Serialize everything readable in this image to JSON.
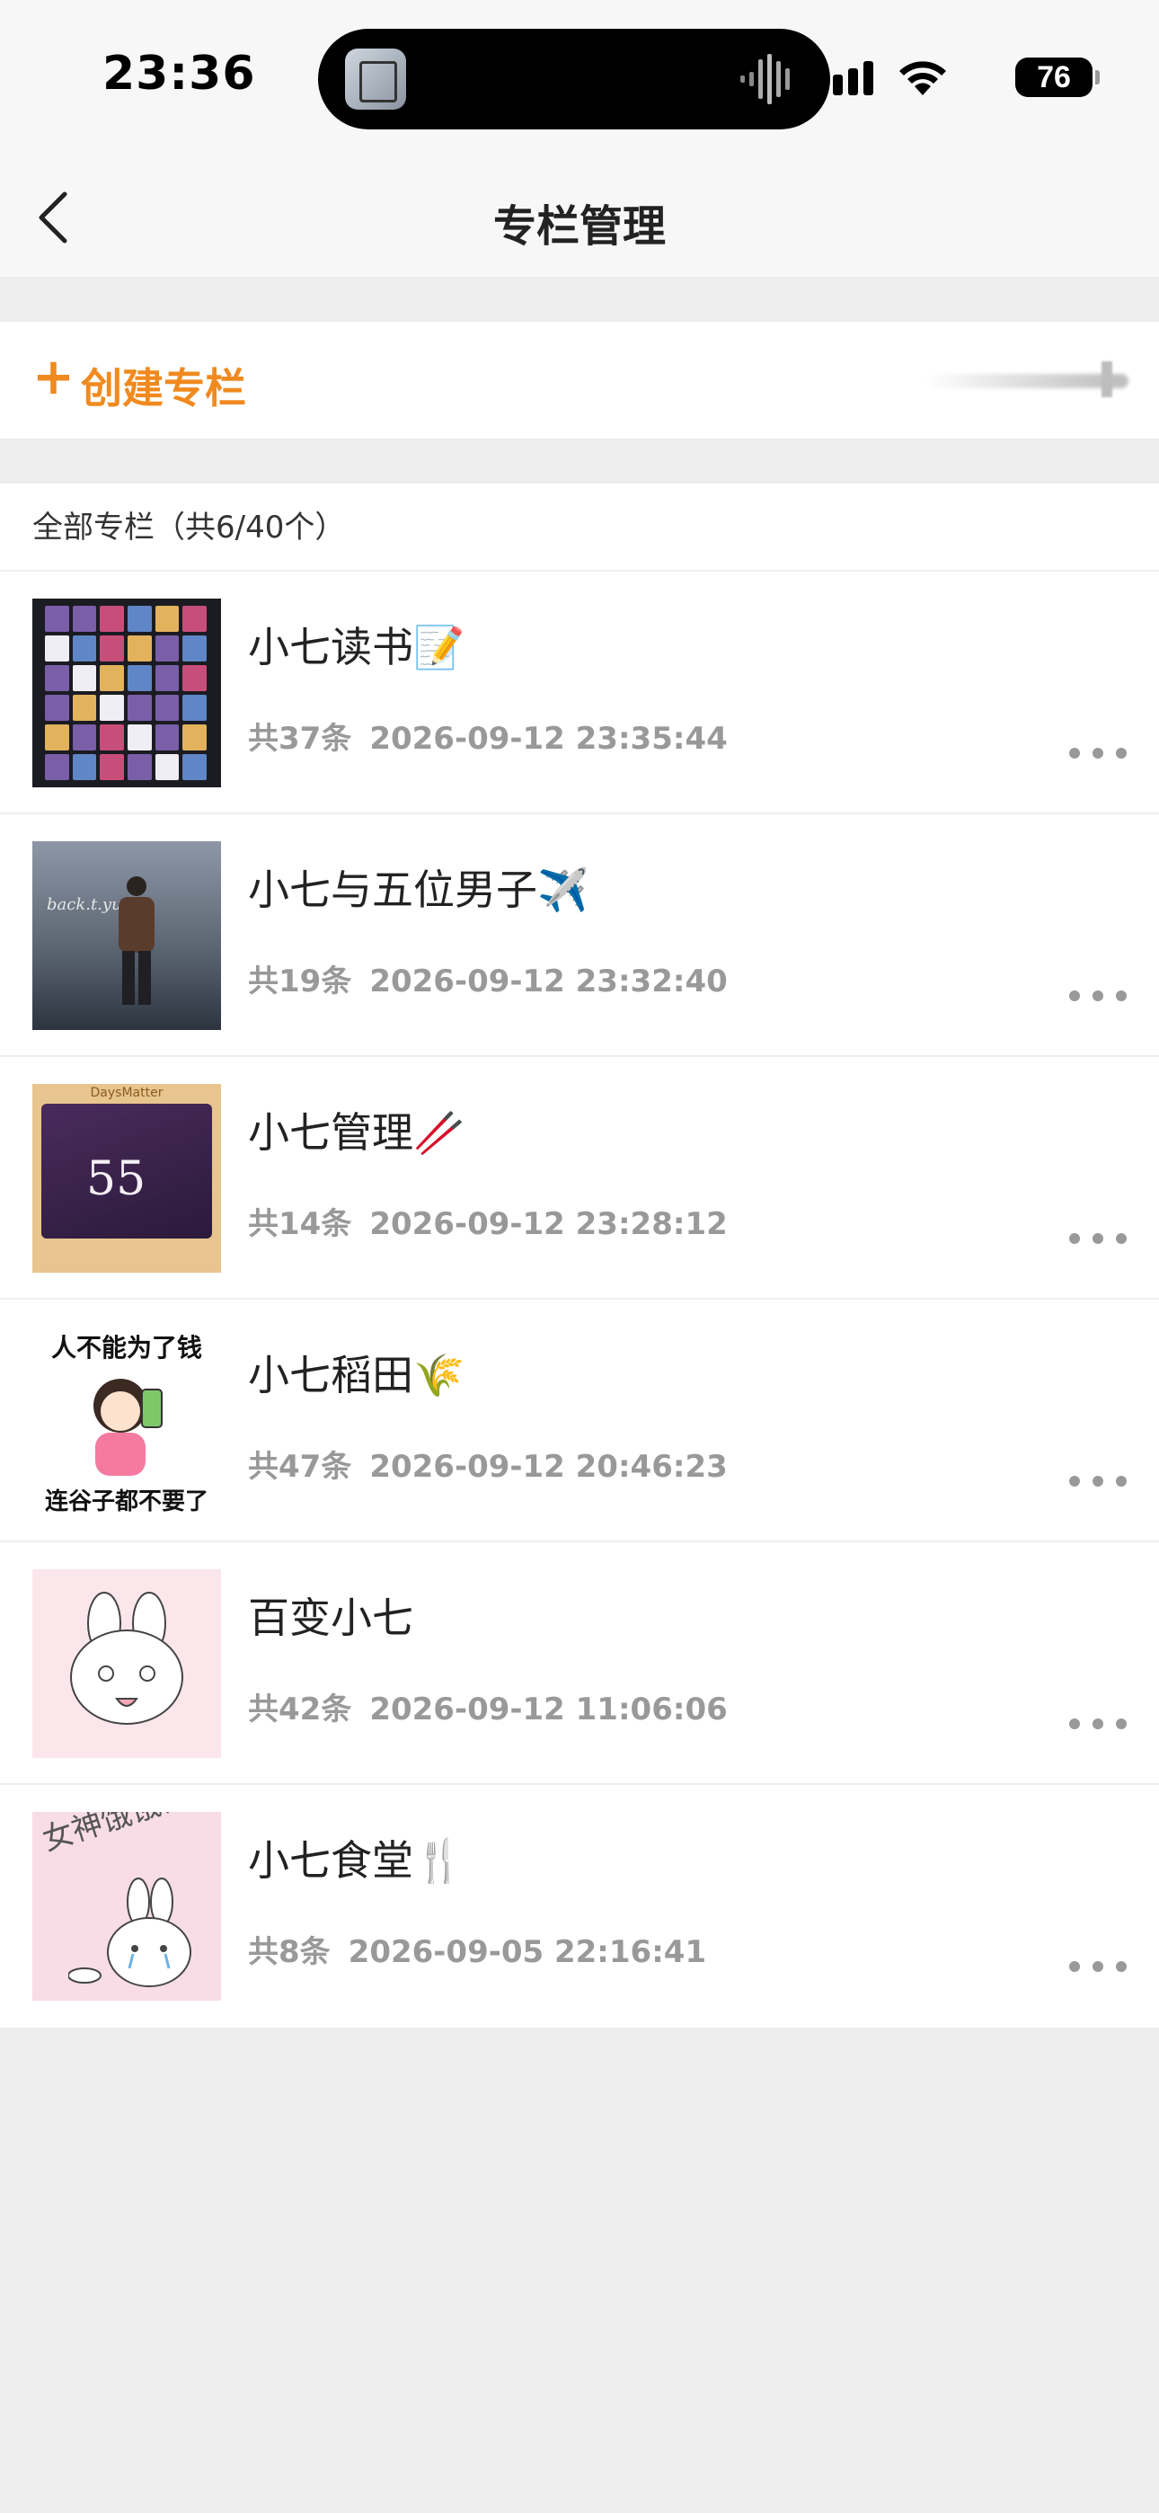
{
  "status_bar": {
    "time": "23:36",
    "battery": "76",
    "icons": [
      "signal-icon",
      "wifi-icon",
      "battery-icon"
    ]
  },
  "nav": {
    "title": "专栏管理",
    "back_icon": "chevron-left-icon"
  },
  "create": {
    "plus": "+",
    "label": "创建专栏"
  },
  "list": {
    "header": "全部专栏（共6/40个）",
    "items": [
      {
        "title": "小七读书📝",
        "count": "共37条",
        "date": "2026-09-12 23:35:44"
      },
      {
        "title": "小七与五位男子✈️",
        "count": "共19条",
        "date": "2026-09-12 23:32:40"
      },
      {
        "title": "小七管理🥢",
        "count": "共14条",
        "date": "2026-09-12 23:28:12"
      },
      {
        "title": "小七稻田🌾",
        "count": "共47条",
        "date": "2026-09-12 20:46:23"
      },
      {
        "title": "百变小七",
        "count": "共42条",
        "date": "2026-09-12 11:06:06"
      },
      {
        "title": "小七食堂🍴",
        "count": "共8条",
        "date": "2026-09-05 22:16:41"
      }
    ]
  },
  "thumbs": {
    "t2_script": "back.t.yun",
    "t3_header": "DaysMatter",
    "t3_number": "55",
    "t4_top": "人不能为了钱",
    "t4_bottom": "连谷子都不要了",
    "t6_scribble": "女神饿饿饭饭"
  },
  "colors": {
    "accent": "#f08a1f",
    "background": "#ededed",
    "meta_text": "#999999"
  }
}
